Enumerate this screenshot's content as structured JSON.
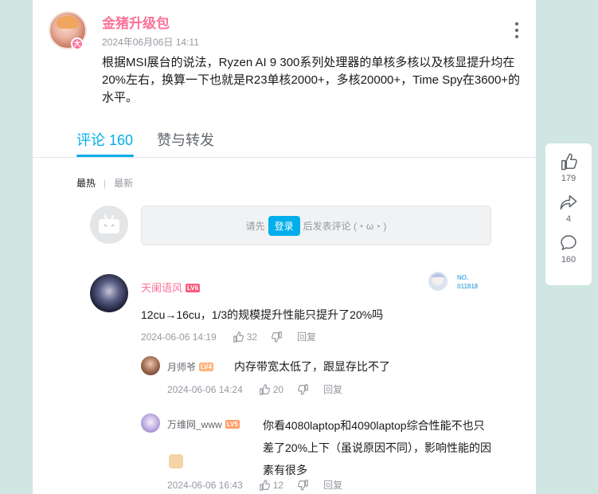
{
  "post": {
    "author": "金猪升级包",
    "time": "2024年06月06日 14:11",
    "badge": "大",
    "text": "根据MSI展台的说法，Ryzen AI 9 300系列处理器的单核多核以及核显提升均在20%左右，换算一下也就是R23单核2000+，多核20000+，Time Spy在3600+的水平。"
  },
  "tabs": [
    {
      "label": "评论",
      "count": "160"
    },
    {
      "label": "赞与转发"
    }
  ],
  "sort": {
    "hot": "最热",
    "sep": "|",
    "new": "最新"
  },
  "login": {
    "prefix": "请先",
    "button": "登录",
    "suffix": "后发表评论 (・ω・)"
  },
  "comments": [
    {
      "user": "天阑语风",
      "level": "LV6",
      "nameplate": {
        "line1": "NO.",
        "line2": "011818"
      },
      "text": "12cu→16cu，1/3的规模提升性能只提升了20%吗",
      "time": "2024-06-06 14:19",
      "likes": "32",
      "reply": "回复",
      "replies": [
        {
          "user": "月师爷",
          "level": "LV4",
          "text": "内存带宽太低了，跟显存比不了",
          "time": "2024-06-06 14:24",
          "likes": "20",
          "reply": "回复"
        },
        {
          "user": "万维网_www",
          "level": "LV5",
          "text": "你看4080laptop和4090laptop综合性能不也只差了20%上下（虽说原因不同），影响性能的因素有很多",
          "time": "2024-06-06 16:43",
          "likes": "12",
          "reply": "回复"
        }
      ]
    }
  ],
  "side": {
    "likes": "179",
    "shares": "4",
    "comments": "160"
  },
  "colors": {
    "accent": "#00aeec",
    "pink": "#fb7299",
    "background": "#cfe6e2"
  }
}
